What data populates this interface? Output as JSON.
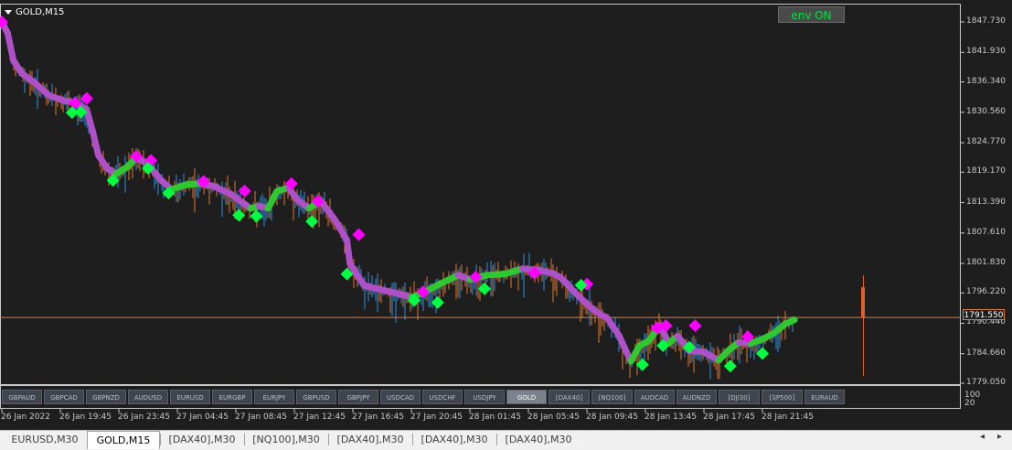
{
  "window": {
    "symbol_title": "GOLD,M15",
    "env_button": "env ON"
  },
  "price_axis": {
    "labels": [
      "1847.730",
      "1841.930",
      "1836.340",
      "1830.560",
      "1824.770",
      "1819.170",
      "1813.390",
      "1807.610",
      "1801.830",
      "1796.220",
      "1790.440",
      "1784.660",
      "1779.050"
    ],
    "current_price": "1791.550"
  },
  "indicator_scale": [
    "100",
    "20"
  ],
  "symbols": [
    "GBPAUD",
    "GBPCAD",
    "GBPNZD",
    "AUDUSD",
    "EURUSD",
    "EURGBP",
    "EURJPY",
    "GBPUSD",
    "GBPJPY",
    "USDCAD",
    "USDCHF",
    "USDJPY",
    "GOLD",
    "[DAX40]",
    "[NQ100]",
    "AUDCAD",
    "AUDNZD",
    "[DJI30]",
    "[SP500]",
    "EURAUD"
  ],
  "active_symbol": "GOLD",
  "time_axis": [
    "26 Jan 2022",
    "26 Jan 19:45",
    "26 Jan 23:45",
    "27 Jan 04:45",
    "27 Jan 08:45",
    "27 Jan 12:45",
    "27 Jan 16:45",
    "27 Jan 20:45",
    "28 Jan 01:45",
    "28 Jan 05:45",
    "28 Jan 09:45",
    "28 Jan 13:45",
    "28 Jan 17:45",
    "28 Jan 21:45"
  ],
  "tabs": [
    "EURUSD,M30",
    "GOLD,M15",
    "[DAX40],M30",
    "[NQ100],M30",
    "[DAX40],M30",
    "[DAX40],M30",
    "[DAX40],M30"
  ],
  "active_tab": "GOLD,M15",
  "colors": {
    "background": "#1e1e1e",
    "trend_down": "#b050c8",
    "trend_up": "#30c830",
    "marker_sell": "#ff00ff",
    "marker_buy": "#00ff40",
    "candle_bull": "#3090e0",
    "candle_bear": "#e07830",
    "price_line": "#e08040"
  },
  "chart_data": {
    "type": "line",
    "title": "",
    "xlabel": "",
    "ylabel": "",
    "ylim": [
      1779.05,
      1847.73
    ],
    "x": [
      "26 Jan 2022",
      "26 Jan 19:45",
      "26 Jan 23:45",
      "27 Jan 04:45",
      "27 Jan 08:45",
      "27 Jan 12:45",
      "27 Jan 16:45",
      "27 Jan 20:45",
      "28 Jan 01:45",
      "28 Jan 05:45",
      "28 Jan 09:45",
      "28 Jan 13:45",
      "28 Jan 17:45",
      "28 Jan 21:45"
    ],
    "series": [
      {
        "points": [
          [
            0,
            1847.7
          ],
          [
            0.1,
            1845.6
          ],
          [
            0.2,
            1840.3
          ],
          [
            0.35,
            1837.9
          ],
          [
            0.55,
            1836.3
          ],
          [
            0.8,
            1833.8
          ],
          [
            1.05,
            1832.8
          ],
          [
            1.25,
            1832.4
          ],
          [
            1.45,
            1831.1
          ],
          [
            1.55,
            1827.1
          ],
          [
            1.65,
            1822.4
          ],
          [
            1.8,
            1819.9
          ],
          [
            1.95,
            1818.8
          ],
          [
            2.15,
            1820.2
          ],
          [
            2.3,
            1822.0
          ],
          [
            2.5,
            1820.7
          ],
          [
            2.7,
            1817.9
          ],
          [
            2.9,
            1815.9
          ],
          [
            3.15,
            1816.8
          ],
          [
            3.4,
            1817.0
          ],
          [
            3.6,
            1816.6
          ],
          [
            3.9,
            1815.1
          ],
          [
            4.05,
            1813.9
          ],
          [
            4.25,
            1812.3
          ],
          [
            4.4,
            1812.7
          ],
          [
            4.55,
            1812.3
          ],
          [
            4.7,
            1815.5
          ],
          [
            4.9,
            1816.3
          ],
          [
            5.05,
            1813.9
          ],
          [
            5.25,
            1812.3
          ],
          [
            5.45,
            1813.7
          ],
          [
            5.7,
            1810.0
          ],
          [
            5.9,
            1806.2
          ],
          [
            5.95,
            1801.8
          ],
          [
            6.05,
            1800.0
          ],
          [
            6.2,
            1797.6
          ],
          [
            6.5,
            1796.8
          ],
          [
            6.8,
            1796.0
          ],
          [
            7.0,
            1795.4
          ],
          [
            7.2,
            1796.2
          ],
          [
            7.5,
            1798.0
          ],
          [
            7.8,
            1799.6
          ],
          [
            8.0,
            1798.8
          ],
          [
            8.3,
            1799.6
          ],
          [
            8.6,
            1799.8
          ],
          [
            8.9,
            1800.8
          ],
          [
            9.15,
            1800.6
          ],
          [
            9.4,
            1800.0
          ],
          [
            9.55,
            1799.2
          ],
          [
            9.75,
            1796.8
          ],
          [
            9.95,
            1794.6
          ],
          [
            10.15,
            1792.7
          ],
          [
            10.35,
            1791.4
          ],
          [
            10.55,
            1788.1
          ],
          [
            10.75,
            1783.2
          ],
          [
            10.9,
            1786.2
          ],
          [
            11.05,
            1787.0
          ],
          [
            11.25,
            1790.0
          ],
          [
            11.4,
            1786.7
          ],
          [
            11.55,
            1788.0
          ],
          [
            11.75,
            1785.2
          ],
          [
            12.0,
            1785.0
          ],
          [
            12.25,
            1783.4
          ],
          [
            12.45,
            1785.6
          ],
          [
            12.6,
            1786.8
          ],
          [
            12.8,
            1786.6
          ],
          [
            13.0,
            1787.4
          ],
          [
            13.2,
            1788.6
          ],
          [
            13.4,
            1790.4
          ],
          [
            13.55,
            1791.1
          ]
        ]
      }
    ],
    "markers": {
      "sell": [
        [
          0,
          1847.7
        ],
        [
          1.25,
          1832.3
        ],
        [
          1.45,
          1833.2
        ],
        [
          2.3,
          1822.2
        ],
        [
          2.55,
          1821.4
        ],
        [
          3.45,
          1817.4
        ],
        [
          4.15,
          1815.6
        ],
        [
          4.95,
          1817.0
        ],
        [
          5.4,
          1813.6
        ],
        [
          6.1,
          1807.3
        ],
        [
          7.2,
          1796.4
        ],
        [
          8.1,
          1799.2
        ],
        [
          9.1,
          1800.0
        ],
        [
          10.0,
          1797.9
        ],
        [
          11.2,
          1789.6
        ],
        [
          11.35,
          1790.0
        ],
        [
          11.85,
          1790.0
        ],
        [
          12.75,
          1787.9
        ]
      ],
      "buy": [
        [
          1.2,
          1830.5
        ],
        [
          1.35,
          1830.6
        ],
        [
          1.9,
          1817.6
        ],
        [
          2.5,
          1819.9
        ],
        [
          2.85,
          1815.2
        ],
        [
          4.05,
          1811.0
        ],
        [
          4.35,
          1810.8
        ],
        [
          5.3,
          1809.8
        ],
        [
          5.9,
          1799.8
        ],
        [
          7.05,
          1794.8
        ],
        [
          7.45,
          1794.4
        ],
        [
          8.25,
          1797.0
        ],
        [
          9.9,
          1797.7
        ],
        [
          10.95,
          1782.6
        ],
        [
          11.3,
          1786.2
        ],
        [
          11.75,
          1785.9
        ],
        [
          12.45,
          1782.3
        ],
        [
          13.0,
          1784.7
        ]
      ]
    },
    "current_price": 1791.55,
    "grid": false
  }
}
